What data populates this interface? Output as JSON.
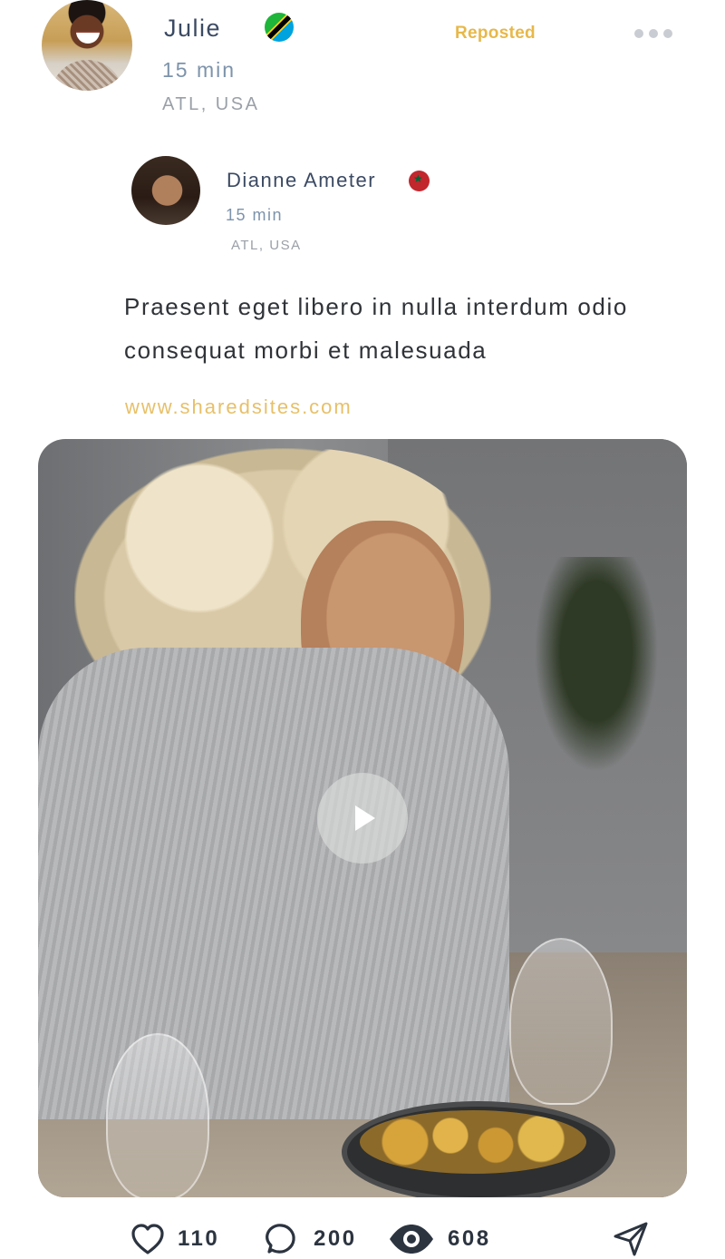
{
  "reposter": {
    "name": "Julie",
    "time": "15 min",
    "location": "ATL, USA",
    "status": "Reposted",
    "flag_icon": "tanzania-flag-icon"
  },
  "original_post": {
    "author": "Dianne Ameter",
    "time": "15 min",
    "location": "ATL, USA",
    "flag_icon": "morocco-flag-icon",
    "text": "Praesent eget libero in nulla interdum odio consequat morbi et malesuada",
    "link": "www.sharedsites.com"
  },
  "media": {
    "type": "video",
    "play_icon": "play-icon"
  },
  "actions": {
    "likes": "110",
    "comments": "200",
    "views": "608"
  },
  "colors": {
    "accent": "#e7b84a",
    "text_primary": "#3b4a63",
    "text_secondary": "#7d93ab",
    "link": "#e7c069"
  }
}
